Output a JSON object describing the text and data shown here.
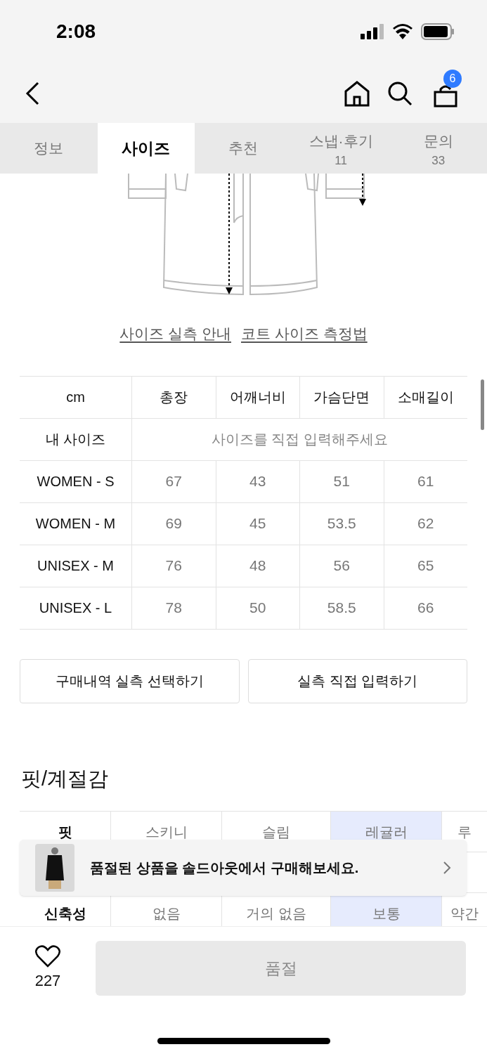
{
  "status_bar": {
    "time": "2:08"
  },
  "header": {
    "cart_count": "6"
  },
  "tabs": [
    {
      "label": "정보",
      "selected": false
    },
    {
      "label": "사이즈",
      "selected": true
    },
    {
      "label": "추천",
      "selected": false
    },
    {
      "label": "스냅·후기",
      "count": "11",
      "selected": false
    },
    {
      "label": "문의",
      "count": "33",
      "selected": false
    }
  ],
  "size_links": [
    "사이즈 실측 안내",
    "코트 사이즈 측정법"
  ],
  "size_table": {
    "columns": [
      "cm",
      "총장",
      "어깨너비",
      "가슴단면",
      "소매길이"
    ],
    "my_size": {
      "label": "내 사이즈",
      "placeholder": "사이즈를 직접 입력해주세요"
    },
    "rows": [
      {
        "label": "WOMEN - S",
        "values": [
          "67",
          "43",
          "51",
          "61"
        ]
      },
      {
        "label": "WOMEN - M",
        "values": [
          "69",
          "45",
          "53.5",
          "62"
        ]
      },
      {
        "label": "UNISEX - M",
        "values": [
          "76",
          "48",
          "56",
          "65"
        ]
      },
      {
        "label": "UNISEX - L",
        "values": [
          "78",
          "50",
          "58.5",
          "66"
        ]
      }
    ]
  },
  "size_buttons": [
    "구매내역 실측 선택하기",
    "실측 직접 입력하기"
  ],
  "fit": {
    "title": "핏/계절감",
    "rows": [
      {
        "label": "핏",
        "cells": [
          {
            "text": "스키니",
            "selected": false
          },
          {
            "text": "슬림",
            "selected": false
          },
          {
            "text": "레귤러",
            "selected": true
          },
          {
            "text": "루",
            "selected": false
          }
        ]
      },
      {
        "label": "신축성",
        "cells": [
          {
            "text": "없음",
            "selected": false
          },
          {
            "text": "거의 없음",
            "selected": false
          },
          {
            "text": "보통",
            "selected": true
          },
          {
            "text": "약간",
            "selected": false
          }
        ]
      }
    ]
  },
  "toast": {
    "message": "품절된 상품을 솔드아웃에서 구매해보세요."
  },
  "bottom_bar": {
    "likes": "227",
    "buy_button": {
      "label": "품절",
      "disabled": true
    }
  }
}
